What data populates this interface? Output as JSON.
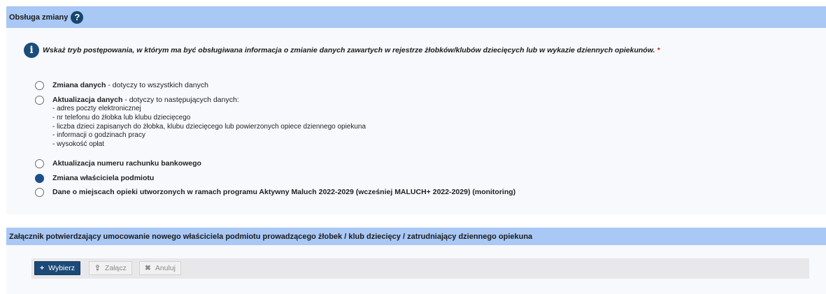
{
  "section1": {
    "title": "Obsługa zmiany",
    "help_icon": "?",
    "info_icon": "i",
    "instruction": "Wskaż tryb postępowania, w którym ma być obsługiwana informacja o zmianie danych zawartych w rejestrze żłobków/klubów dziecięcych lub w wykazie dziennych opiekunów.",
    "required_marker": "*",
    "options": [
      {
        "bold": "Zmiana danych",
        "rest": " - dotyczy to wszystkich danych",
        "checked": false
      },
      {
        "bold": "Aktualizacja danych",
        "rest": " - dotyczy to następujących danych:",
        "checked": false,
        "sublist": [
          "- adres poczty elektronicznej",
          "- nr telefonu do żłobka lub klubu dziecięcego",
          "- liczba dzieci zapisanych do żłobka, klubu dziecięcego lub powierzonych opiece dziennego opiekuna",
          "- informacji o godzinach pracy",
          "- wysokość opłat"
        ]
      },
      {
        "bold": "Aktualizacja numeru rachunku bankowego",
        "rest": "",
        "checked": false
      },
      {
        "bold": "Zmiana właściciela podmiotu",
        "rest": "",
        "checked": true
      },
      {
        "bold": "Dane o miejscach opieki utworzonych w ramach programu Aktywny Maluch 2022-2029 (wcześniej MALUCH+ 2022-2029) (monitoring)",
        "rest": "",
        "checked": false
      }
    ]
  },
  "section2": {
    "title": "Załącznik potwierdzający umocowanie nowego właściciela podmiotu prowadzącego żłobek / klub dziecięcy / zatrudniający dziennego opiekuna",
    "buttons": {
      "choose": {
        "label": "Wybierz",
        "icon": "+",
        "icon_name": "plus-icon"
      },
      "attach": {
        "label": "Załącz",
        "icon": "⇪",
        "icon_name": "upload-icon"
      },
      "cancel": {
        "label": "Anuluj",
        "icon": "✖",
        "icon_name": "close-icon"
      }
    }
  },
  "colors": {
    "header_bg": "#a9c8f5",
    "panel_bg": "#f7f9fc",
    "primary": "#1c4a78",
    "required": "#d81c1c"
  }
}
